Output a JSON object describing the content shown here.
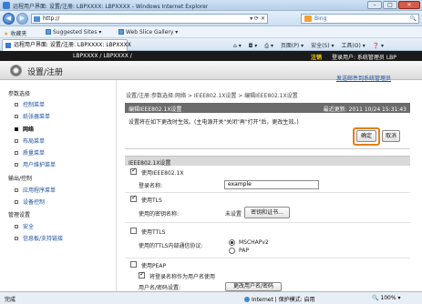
{
  "window": {
    "title": "远程用户界面: 设置/注册: LBPXXXX: LBPXXXX - Windows Internet Explorer",
    "controls": {
      "minimize": "–",
      "maximize": "□",
      "close": "✕"
    }
  },
  "browser": {
    "address": "http://",
    "search_placeholder": "Bing",
    "favorites_label": "收藏夹",
    "suggested_sites": "Suggested Sites ▾",
    "web_slice": "Web Slice Gallery ▾",
    "tab_title": "远程用户界面: 设置/注册: LBPXXXX: LBPXXXX",
    "tools": {
      "page": "页面(P) ▾",
      "safety": "安全(S) ▾",
      "tools": "工具(O) ▾",
      "help": "❓ ▾"
    },
    "icons": [
      "back-icon",
      "forward-icon",
      "refresh-icon",
      "stop-icon",
      "home-icon",
      "print-icon"
    ]
  },
  "app": {
    "model": "LBPXXXX / LBPXXXX /",
    "logout": "注销",
    "login_user": "登录用户: 系统管理员 LBP",
    "title": "设置/注册",
    "admin_link": "发送邮件到系统管理员"
  },
  "sidebar": {
    "sections": [
      {
        "label": "参数选择",
        "items": [
          {
            "label": "控制菜单",
            "active": false
          },
          {
            "label": "纸张器菜单",
            "active": false
          },
          {
            "label": "网络",
            "active": true
          },
          {
            "label": "布局菜单",
            "active": false
          },
          {
            "label": "质量菜单",
            "active": false
          },
          {
            "label": "用户维护菜单",
            "active": false
          }
        ]
      },
      {
        "label": "输出/控制",
        "items": [
          {
            "label": "应用程序菜单",
            "active": false
          },
          {
            "label": "设备控制",
            "active": false
          }
        ]
      },
      {
        "label": "管理设置",
        "items": [
          {
            "label": "安全",
            "active": false
          },
          {
            "label": "信息板/支持链接",
            "active": false
          }
        ]
      }
    ]
  },
  "main": {
    "breadcrumb": "设置/注册:参数选择:网络 > IEEE802.1X设置 > 编辑IEEE802.1X设置",
    "panel_title": "编辑IEEE802.1X设置",
    "last_updated": "最近更新: 2011 10/24 15:31:43",
    "message": "设置将在如下更改时生效。(主电源开关\"关闭\"再\"打开\"后，更改生效。)",
    "ok_label": "确定",
    "cancel_label": "取消",
    "section_title": "IEEE802.1X设置",
    "use_ieee": {
      "label": "使用IEEE802.1X",
      "checked": true
    },
    "login_name_label": "登录名称:",
    "login_name_value": "example",
    "use_tls": {
      "label": "使用TLS",
      "checked": true
    },
    "tls_key_label": "使用的密钥名称:",
    "tls_key_value": "未设置",
    "key_cert_button": "密钥和证书...",
    "use_ttls": {
      "label": "使用TTLS",
      "checked": false
    },
    "ttls_protocol_label": "使用的TTLS内部通信协议:",
    "ttls_options": [
      {
        "label": "MSCHAPv2",
        "selected": true
      },
      {
        "label": "PAP",
        "selected": false
      }
    ],
    "use_peap": {
      "label": "使用PEAP",
      "checked": false
    },
    "use_login_as_user": {
      "label": "将登录名称作为用户名使用",
      "checked": true
    },
    "username_password_label": "用户名/密码设置:",
    "change_button": "更改用户名/密码"
  },
  "status_bar": {
    "left": "完成",
    "zone": "Internet | 保护模式: 启用",
    "zoom": "100%"
  }
}
